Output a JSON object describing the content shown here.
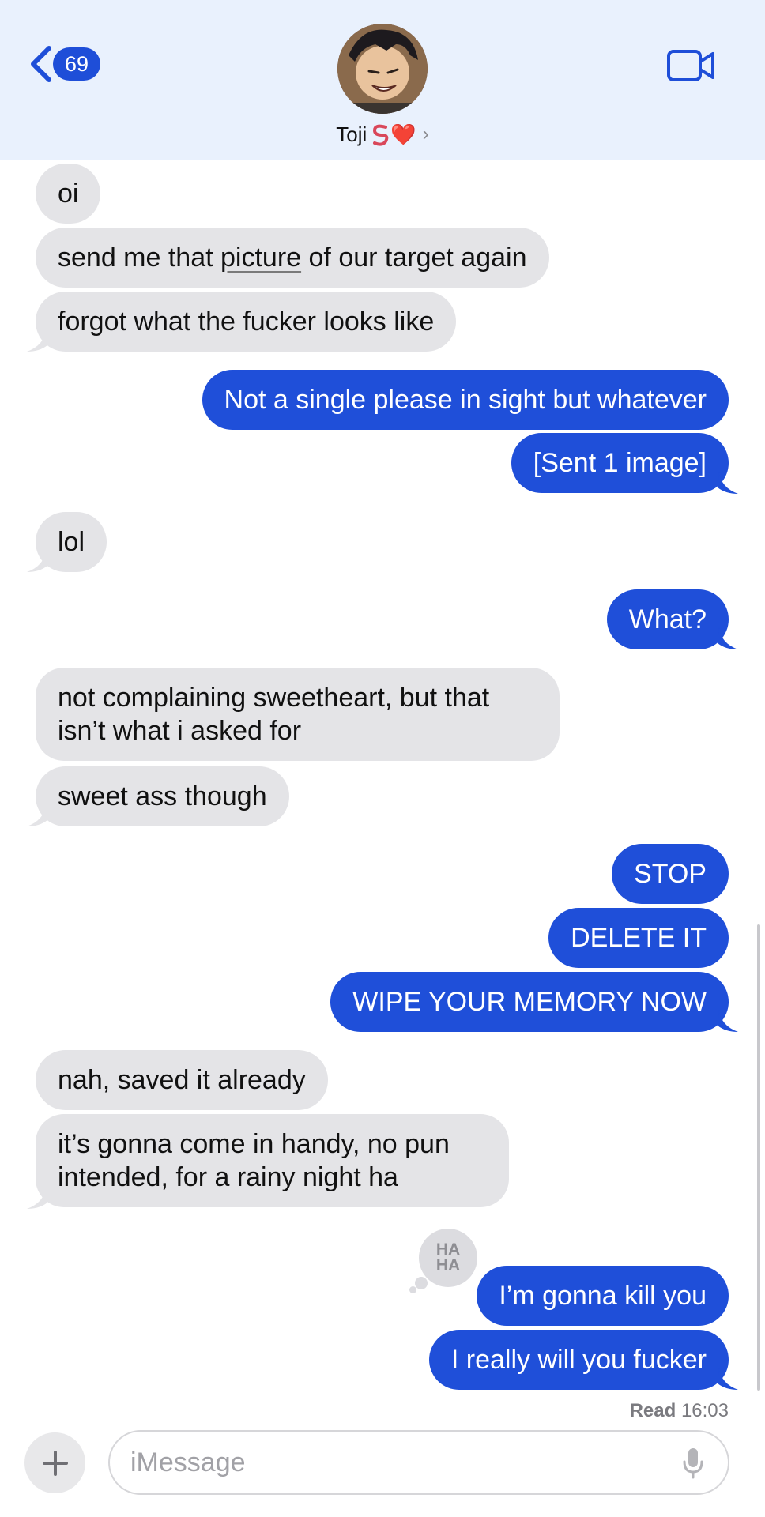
{
  "header": {
    "back_badge": "69",
    "contact_name": "Toji",
    "contact_emoji": "❤️"
  },
  "messages": [
    {
      "dir": "in",
      "text": "oi"
    },
    {
      "dir": "in",
      "text_before": "send me that ",
      "text_link": "picture",
      "text_after": " of our target again"
    },
    {
      "dir": "in",
      "text": "forgot what the fucker looks like"
    },
    {
      "dir": "out",
      "text": "Not a single please in sight but whatever"
    },
    {
      "dir": "out",
      "text": "[Sent 1 image]"
    },
    {
      "dir": "in",
      "text": "lol"
    },
    {
      "dir": "out",
      "text": "What?"
    },
    {
      "dir": "in",
      "line1": "not complaining sweetheart, but that",
      "line2": "isn’t what i asked for"
    },
    {
      "dir": "in",
      "text": "sweet ass though"
    },
    {
      "dir": "out",
      "text": "STOP"
    },
    {
      "dir": "out",
      "text": "DELETE IT"
    },
    {
      "dir": "out",
      "text": "WIPE YOUR MEMORY NOW"
    },
    {
      "dir": "in",
      "text": "nah, saved it already"
    },
    {
      "dir": "in",
      "line1": "it’s gonna come in handy, no pun",
      "line2": "intended, for a rainy night ha"
    },
    {
      "dir": "out",
      "text": "I’m gonna kill you",
      "tapback_line1": "HA",
      "tapback_line2": "HA"
    },
    {
      "dir": "out",
      "text": "I really will you fucker"
    }
  ],
  "read_receipt": {
    "label": "Read",
    "time": "16:03"
  },
  "composer": {
    "placeholder": "iMessage"
  },
  "colors": {
    "outgoing": "#1f4fd9",
    "incoming": "#e4e4e7",
    "header": "#e9f1fd"
  }
}
